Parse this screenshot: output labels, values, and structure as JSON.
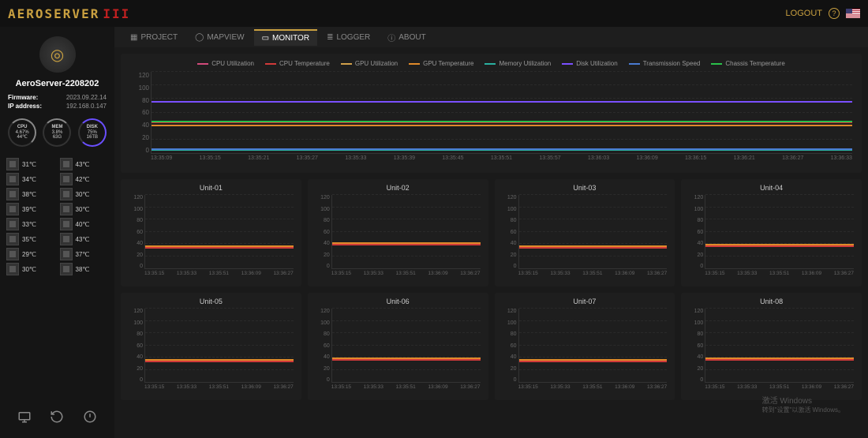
{
  "header": {
    "logo_text": "AEROSERVER",
    "logo_suffix": "III",
    "logout": "LOGOUT",
    "help_icon": "?"
  },
  "sidebar": {
    "server_name": "AeroServer-2208202",
    "firmware_label": "Firmware:",
    "firmware_value": "2023.09.22.14",
    "ip_label": "IP address:",
    "ip_value": "192.168.0.147",
    "gauges": {
      "cpu": {
        "label": "CPU",
        "line1": "4.67%",
        "line2": "44℃"
      },
      "mem": {
        "label": "MEM",
        "line1": "3.8%",
        "line2": "63G"
      },
      "disk": {
        "label": "DISK",
        "line1": "75%",
        "line2": "16TB"
      }
    },
    "temps": [
      "31℃",
      "43℃",
      "34℃",
      "42℃",
      "38℃",
      "30℃",
      "39℃",
      "30℃",
      "33℃",
      "40℃",
      "35℃",
      "43℃",
      "29℃",
      "37℃",
      "30℃",
      "38℃"
    ]
  },
  "tabs": [
    {
      "icon": "▦",
      "label": "PROJECT"
    },
    {
      "icon": "◯",
      "label": "MAPVIEW"
    },
    {
      "icon": "▭",
      "label": "MONITOR",
      "active": true
    },
    {
      "icon": "≣",
      "label": "LOGGER"
    },
    {
      "icon": "ⓘ",
      "label": "ABOUT"
    }
  ],
  "legend": [
    {
      "color": "#d14a7a",
      "label": "CPU Utilization"
    },
    {
      "color": "#d13a3a",
      "label": "CPU Temperature"
    },
    {
      "color": "#d1a04a",
      "label": "GPU Utilization"
    },
    {
      "color": "#e08a2a",
      "label": "GPU Temperature"
    },
    {
      "color": "#2ab0a0",
      "label": "Memory Utilization"
    },
    {
      "color": "#7a4fff",
      "label": "Disk Utilization"
    },
    {
      "color": "#4a7ad1",
      "label": "Transmission Speed"
    },
    {
      "color": "#2ac04a",
      "label": "Chassis Temperature"
    }
  ],
  "chart_data": {
    "type": "line",
    "ylim": [
      0,
      120
    ],
    "yticks": [
      0,
      20,
      40,
      60,
      80,
      100,
      120
    ],
    "x_labels": [
      "13:35:09",
      "13:35:15",
      "13:35:21",
      "13:35:27",
      "13:35:33",
      "13:35:39",
      "13:35:45",
      "13:35:51",
      "13:35:57",
      "13:36:03",
      "13:36:09",
      "13:36:15",
      "13:36:21",
      "13:36:27",
      "13:36:33"
    ],
    "series": [
      {
        "name": "CPU Utilization",
        "color": "#d14a7a",
        "approx": 5
      },
      {
        "name": "CPU Temperature",
        "color": "#d13a3a",
        "approx": 44
      },
      {
        "name": "GPU Utilization",
        "color": "#d1a04a",
        "approx": 4
      },
      {
        "name": "GPU Temperature",
        "color": "#e08a2a",
        "approx": 40
      },
      {
        "name": "Memory Utilization",
        "color": "#2ab0a0",
        "approx": 4
      },
      {
        "name": "Disk Utilization",
        "color": "#7a4fff",
        "approx": 75
      },
      {
        "name": "Transmission Speed",
        "color": "#4a7ad1",
        "approx": 5
      },
      {
        "name": "Chassis Temperature",
        "color": "#2ac04a",
        "approx": 45
      }
    ],
    "units": {
      "yticks": [
        0,
        20,
        40,
        60,
        80,
        100,
        120
      ],
      "x_labels": [
        "13:35:15",
        "13:35:33",
        "13:35:51",
        "13:36:09",
        "13:36:27"
      ],
      "list": [
        {
          "title": "Unit-01",
          "approx": 35
        },
        {
          "title": "Unit-02",
          "approx": 40
        },
        {
          "title": "Unit-03",
          "approx": 35
        },
        {
          "title": "Unit-04",
          "approx": 38
        },
        {
          "title": "Unit-05",
          "approx": 35
        },
        {
          "title": "Unit-06",
          "approx": 38
        },
        {
          "title": "Unit-07",
          "approx": 35
        },
        {
          "title": "Unit-08",
          "approx": 38
        }
      ]
    }
  },
  "watermark": {
    "line1": "激活 Windows",
    "line2": "转到\"设置\"以激活 Windows。"
  }
}
